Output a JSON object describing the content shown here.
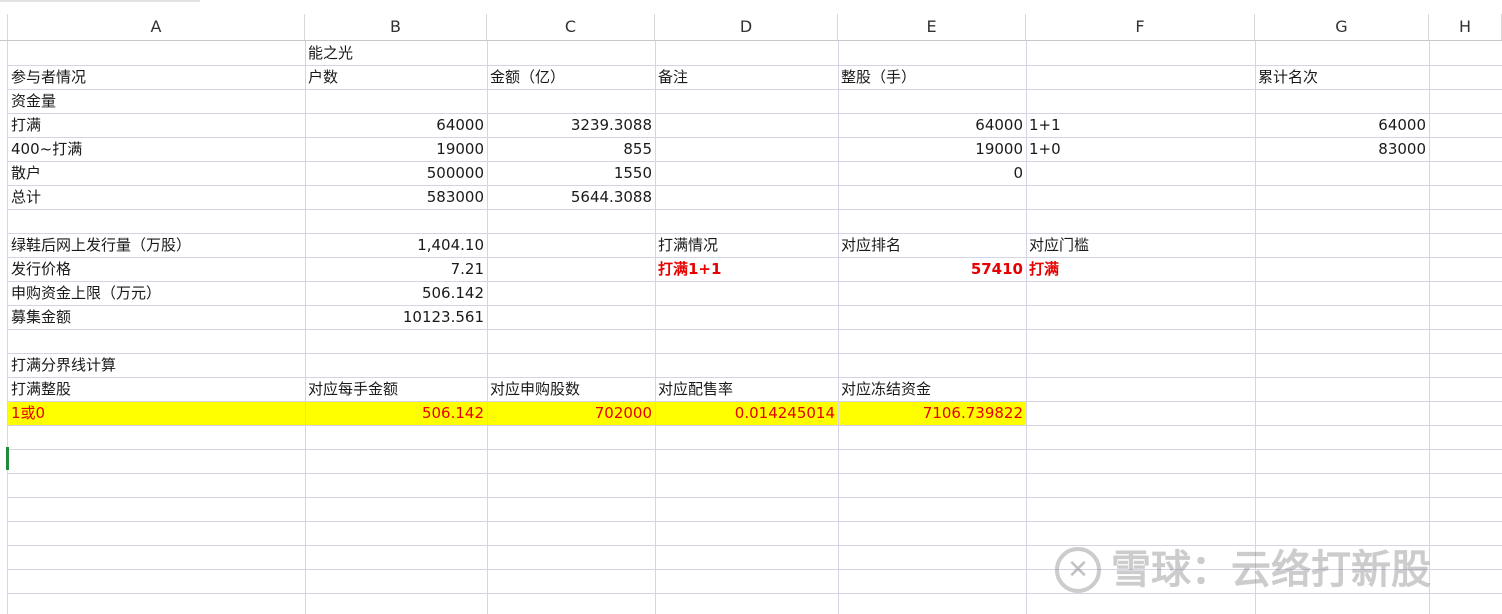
{
  "columns": [
    "A",
    "B",
    "C",
    "D",
    "E",
    "F",
    "G",
    "H"
  ],
  "cells": {
    "r1": {
      "B": "能之光"
    },
    "r2": {
      "A": "参与者情况",
      "B": "户数",
      "C": "金额（亿）",
      "D": "备注",
      "E": "整股（手）",
      "G": "累计名次"
    },
    "r3": {
      "A": "资金量"
    },
    "r4": {
      "A": "打满",
      "B": "64000",
      "C": "3239.3088",
      "E": "64000",
      "F": "1+1",
      "G": "64000"
    },
    "r5": {
      "A": "400~打满",
      "B": "19000",
      "C": "855",
      "E": "19000",
      "F": "1+0",
      "G": "83000"
    },
    "r6": {
      "A": "散户",
      "B": "500000",
      "C": "1550",
      "E": "0"
    },
    "r7": {
      "A": "总计",
      "B": "583000",
      "C": "5644.3088"
    },
    "r9": {
      "A": "绿鞋后网上发行量（万股）",
      "B": "1,404.10",
      "D": "打满情况",
      "E": "对应排名",
      "F": "对应门槛"
    },
    "r10": {
      "A": "发行价格",
      "B": "7.21",
      "D": "打满1+1",
      "E": "57410",
      "F": "打满"
    },
    "r11": {
      "A": "申购资金上限（万元）",
      "B": "506.142"
    },
    "r12": {
      "A": "募集金额",
      "B": "10123.561"
    },
    "r14": {
      "A": "打满分界线计算"
    },
    "r15": {
      "A": "打满整股",
      "B": "对应每手金额",
      "C": "对应申购股数",
      "D": "对应配售率",
      "E": "对应冻结资金"
    },
    "r16": {
      "A": "1或0",
      "B": "506.142",
      "C": "702000",
      "D": "0.014245014",
      "E": "7106.739822"
    }
  },
  "colors": {
    "highlight": "#ffff00",
    "accent_red": "#e60000",
    "active_cell": "#1e8a3c"
  },
  "watermark": {
    "text": "雪球：云络打新股",
    "icon": "snowball-logo-icon"
  }
}
